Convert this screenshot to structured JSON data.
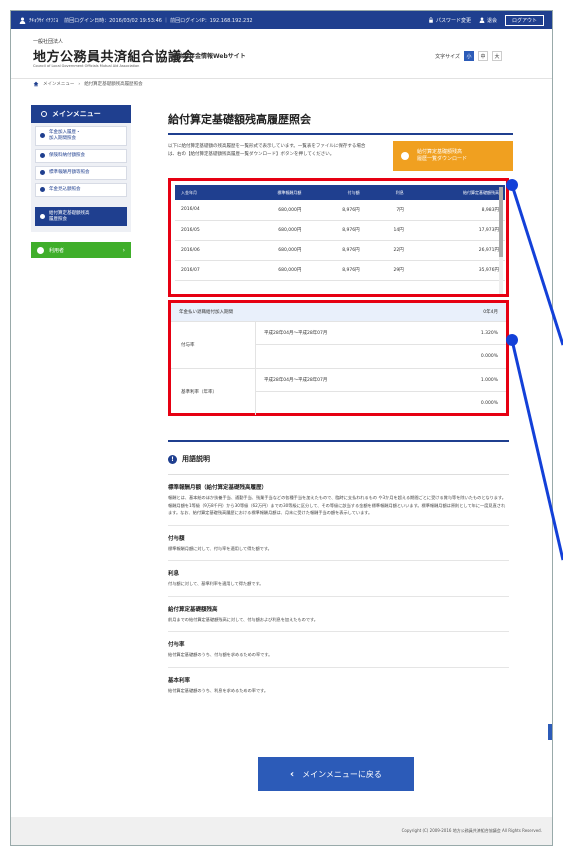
{
  "topbar": {
    "user_name": "ﾁｷｮｳｻｲ ｲﾁﾌﾐﾖ",
    "session_info": "前回ログイン日時：2016/03/02 19:53:46 ｜ 前回ログインIP：192.168.192.232",
    "password_label": "パスワード変更",
    "withdraw_label": "退会",
    "logout_label": "ログアウト"
  },
  "header": {
    "org_small": "一般社団法人",
    "org_title": "地方公務員共済組合協議会",
    "org_sub": "地共済年金情報Webサイト",
    "org_en": "Council of Local Government Officials Mutual Aid Association",
    "fontsize_label": "文字サイズ",
    "fontsize_options": [
      "小",
      "中",
      "大"
    ]
  },
  "breadcrumb": {
    "home": "メインメニュー",
    "separator": "›",
    "current": "給付算定基礎額残高履歴照会"
  },
  "sidebar": {
    "title": "メインメニュー",
    "items": [
      {
        "label": "年金加入履歴・\n加入期間照会"
      },
      {
        "label": "保険料納付額照会"
      },
      {
        "label": "標準報酬月額等照会"
      },
      {
        "label": "年金見込額照会"
      }
    ],
    "active_item": "給付算定基礎額残高\n履歴照会",
    "green_button": "利用者"
  },
  "main": {
    "page_title": "給付算定基礎額残高履歴照会",
    "intro": "以下に給付算定基礎額の残高履歴を一覧形式で表示しています。一覧表をファイルに保存する場合は、右の【給付算定基礎額残高履歴一覧ダウンロード】ボタンを押してください。",
    "download_label": "給付算定基礎額残高\n履歴一覧ダウンロード"
  },
  "history_table": {
    "headers": [
      "入金年月",
      "標準報酬月額",
      "付与額",
      "利息",
      "給付算定基礎額残高"
    ],
    "rows": [
      [
        "2016/04",
        "680,000円",
        "8,976円",
        "7円",
        "8,983円"
      ],
      [
        "2016/05",
        "680,000円",
        "8,976円",
        "14円",
        "17,973円"
      ],
      [
        "2016/06",
        "680,000円",
        "8,976円",
        "22円",
        "26,971円"
      ],
      [
        "2016/07",
        "680,000円",
        "8,976円",
        "29円",
        "35,976円"
      ]
    ]
  },
  "rates": {
    "head_label": "年金払い退職給付加入期間",
    "head_value": "0年4月",
    "groups": [
      {
        "label": "付与率",
        "rows": [
          {
            "period": "平成28年04月～平成28年07月",
            "value": "1.320%"
          },
          {
            "period": "",
            "value": "0.000%"
          }
        ]
      },
      {
        "label": "基準利率（年率）",
        "rows": [
          {
            "period": "平成28年04月～平成28年07月",
            "value": "1.000%"
          },
          {
            "period": "",
            "value": "0.000%"
          }
        ]
      }
    ]
  },
  "glossary": {
    "title": "用語説明",
    "terms": [
      {
        "name": "標準報酬月額（給付算定基礎残高履歴）",
        "desc": "報酬とは、基本給のほか扶養手当、通勤手当、残業手当などの各種手当を加えたもので、臨時に支払われるもの や3か月を超える期間ごとに受ける賞与等を除いたものとなります。報酬月額を1等級（9万8千円）から30等級（62万円）までの30等級に区分して、その等級に該当する金額を標準報酬月額といいます。標準報酬月額は原則として年に一度見直されます。なお、給付算定基礎残高履歴における標準報酬月額は、月末に受けた報酬手当の額を表示しています。"
      },
      {
        "name": "付与額",
        "desc": "標準報酬月額に対して、付与率を適用して得た額です。"
      },
      {
        "name": "利息",
        "desc": "付与額に対して、基準利率を適用して得た額です。"
      },
      {
        "name": "給付算定基礎額残高",
        "desc": "前月までの給付算定基礎額残高に対して、付与額および利息を加えたものです。"
      },
      {
        "name": "付与率",
        "desc": "給付算定基礎額のうち、付与額を求めるための率です。"
      },
      {
        "name": "基本利率",
        "desc": "給付算定基礎額のうち、利息を求めるための率です。"
      }
    ]
  },
  "back_button": "メインメニューに戻る",
  "footer": "Copyright (C) 2009-2016 地方公務員共済組合協議会 All Rights Reserved.",
  "colors": {
    "primary": "#1f3f8f",
    "accent_orange": "#f0a020",
    "highlight_red": "#e60012",
    "callout_blue": "#1340d8",
    "green": "#3fae2a"
  }
}
